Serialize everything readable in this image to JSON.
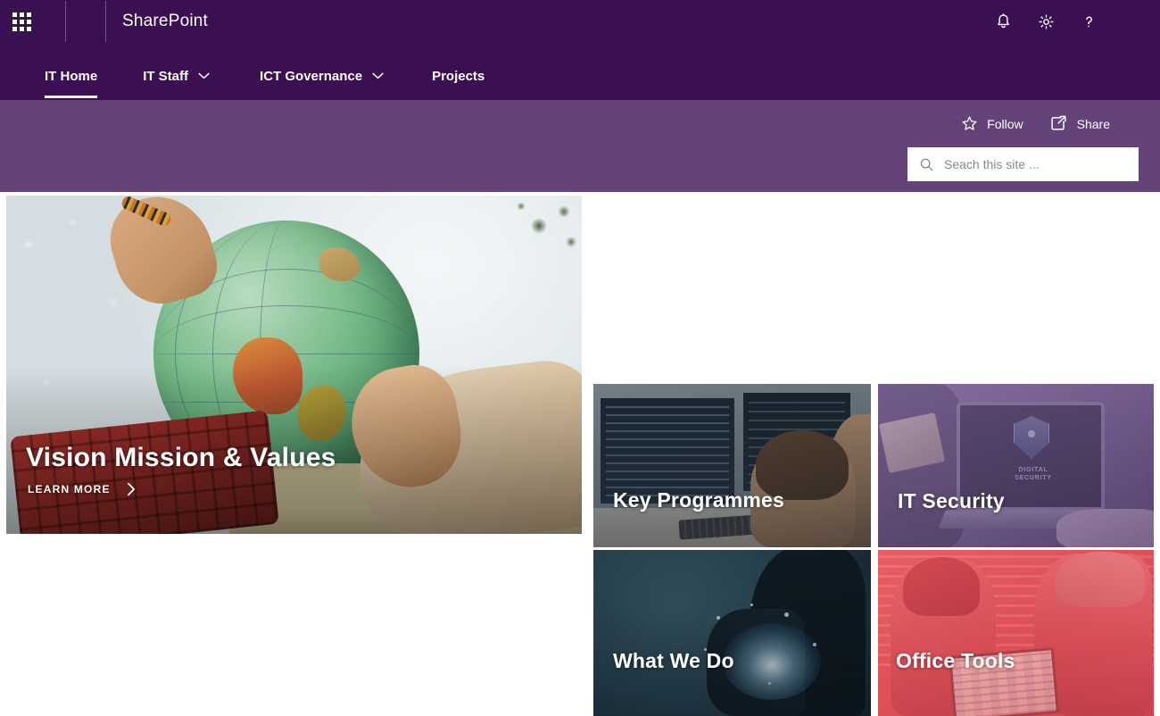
{
  "suite": {
    "app_launcher_icon": "waffle-grid-icon",
    "brand": "SharePoint",
    "actions": [
      {
        "name": "notifications",
        "icon": "bell-icon"
      },
      {
        "name": "settings",
        "icon": "gear-icon"
      },
      {
        "name": "help",
        "icon": "question-mark-icon"
      }
    ]
  },
  "nav": {
    "items": [
      {
        "label": "IT Home",
        "active": true,
        "has_chevron": false
      },
      {
        "label": "IT Staff",
        "active": false,
        "has_chevron": true
      },
      {
        "label": "ICT Governance",
        "active": false,
        "has_chevron": true
      },
      {
        "label": "Projects",
        "active": false,
        "has_chevron": false
      }
    ]
  },
  "site_actions": {
    "follow_label": "Follow",
    "follow_icon": "star-outline-icon",
    "share_label": "Share",
    "share_icon": "share-icon"
  },
  "search": {
    "placeholder": "Seach this site ...",
    "value": "",
    "icon": "search-icon"
  },
  "tiles": {
    "hero": {
      "title": "Vision  Mission & Values",
      "cta_label": "LEARN MORE",
      "cta_icon": "chevron-right-icon"
    },
    "key_programmes": {
      "title": "Key Programmes"
    },
    "it_security": {
      "title": "IT Security",
      "image_caption_line1": "DIGITAL",
      "image_caption_line2": "SECURITY"
    },
    "what_we_do": {
      "title": "What We Do"
    },
    "office_tools": {
      "title": "Office Tools"
    }
  },
  "colors": {
    "suite_bar": "#3b1053",
    "nav_bar": "#3b1053",
    "site_header": "#634378",
    "tile_security_tint": "#856aa0",
    "tile_office_tint": "#e0555c",
    "tile_what_we_do": "#27414f",
    "search_background": "#ffffff",
    "text_on_purple": "#ffffff"
  }
}
